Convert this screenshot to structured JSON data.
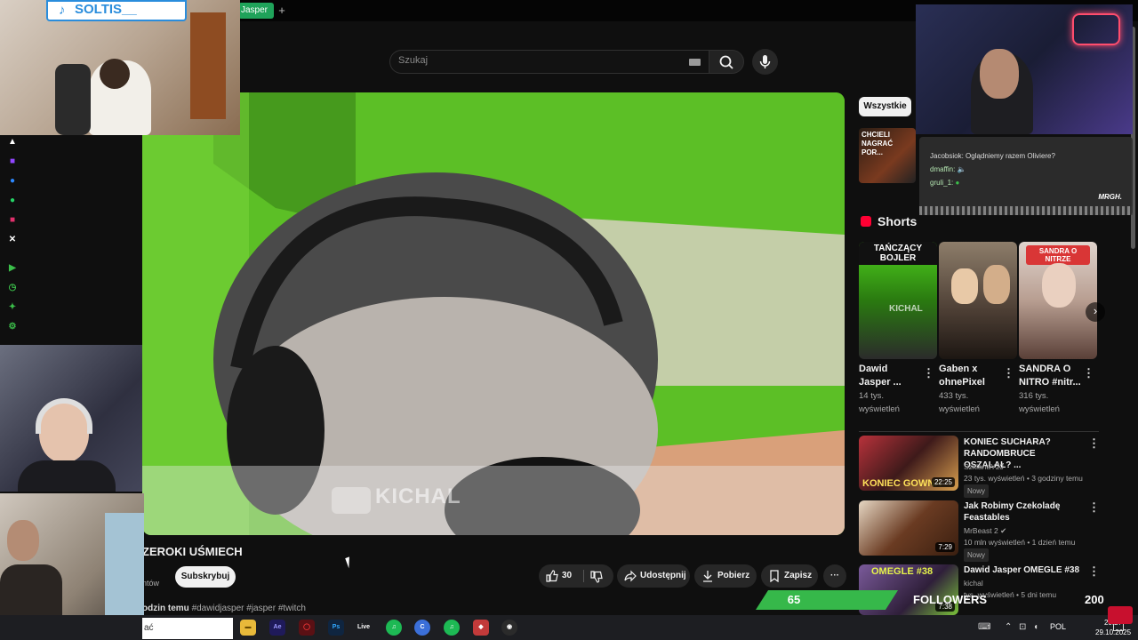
{
  "browser": {
    "active_tab_label": "Jasper",
    "new_tab_symbol": "+"
  },
  "search": {
    "placeholder": "Szukaj"
  },
  "video": {
    "title": "ZEROKI UŚMIECH",
    "channel_subtext": "ntów",
    "subscribe_label": "Subskrybuj",
    "likes": "30",
    "share_label": "Udostępnij",
    "download_label": "Pobierz",
    "save_label": "Zapisz",
    "more_symbol": "···",
    "watermark": "KICHAL",
    "description_time": "odzin temu",
    "description_tags": "#dawidjasper #jasper #twitch"
  },
  "sidebar": {
    "chip_all": "Wszystkie",
    "rec_thumb_caption": "CHCIELI NAGRAĆ POR...",
    "shorts_title": "Shorts",
    "shorts": [
      {
        "overlay": "TAŃCZĄCY BOJLER",
        "title_line1": "Dawid",
        "title_line2": "Jasper ...",
        "views_line1": "14 tys.",
        "views_line2": "wyświetleń",
        "watermark": "KICHAL"
      },
      {
        "overlay": "",
        "title_line1": "Gaben x",
        "title_line2": "ohnePixel",
        "views_line1": "433 tys.",
        "views_line2": "wyświetleń",
        "watermark": ""
      },
      {
        "overlay": "SANDRA O NITRZE",
        "title_line1": "SANDRA O",
        "title_line2": "NITRO #nitr...",
        "views_line1": "316 tys.",
        "views_line2": "wyświetleń",
        "watermark": ""
      }
    ],
    "next_symbol": "›",
    "recommended": [
      {
        "title": "KONIEC SUCHARA? RANDOMBRUCE OSZALAŁ? ...",
        "channel": "SzklanaY2J",
        "meta": "23 tys. wyświetleń • 3 godziny temu",
        "badge": "Nowy",
        "duration": "22:25",
        "thumb_text": "KONIEC GOWNA"
      },
      {
        "title": "Jak Robimy Czekoladę Feastables",
        "channel": "MrBeast 2 ✔",
        "meta": "10 mln wyświetleń • 1 dzień temu",
        "badge": "Nowy",
        "duration": "7:29",
        "thumb_text": ""
      },
      {
        "title": "Dawid Jasper OMEGLE #38",
        "channel": "kichal",
        "meta": "tys. wyświetleń • 5 dni temu",
        "badge": "",
        "duration": "7:38",
        "thumb_text": "OMEGLE #38"
      }
    ]
  },
  "overlays": {
    "tiktok_name": "SOLTIS__",
    "tiktok_icon": "♪",
    "chat": [
      {
        "user": "Jacobsiok:",
        "text": "Oglądniemy razem Oliviere?"
      },
      {
        "user": "dmaffin:",
        "text": "🔈"
      },
      {
        "user": "gruli_1:",
        "text": "●"
      }
    ],
    "chat_tag": "MRGH."
  },
  "followers": {
    "count": "65",
    "label": "FOLLOWERS",
    "goal": "200"
  },
  "taskbar": {
    "search_text": "ać",
    "apps": [
      "▬",
      "Ae",
      "◯",
      "Ps",
      "Live",
      "♫",
      "C",
      "♫",
      "◆",
      "◉"
    ],
    "lang": "POL",
    "time": "20:27",
    "date": "29.10.2025"
  },
  "colors": {
    "accent_green": "#36b84a",
    "tab_green": "#1fa35a",
    "shorts_red": "#ff0033",
    "tiktok_blue": "#2a8ddc"
  }
}
